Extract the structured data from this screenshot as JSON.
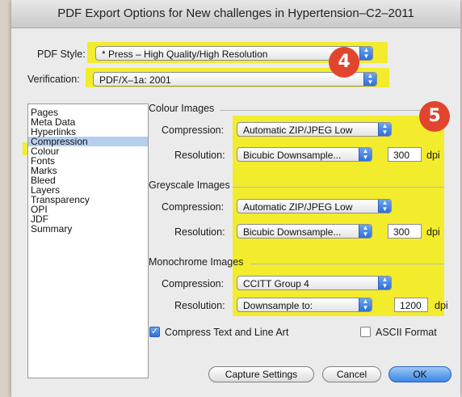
{
  "window": {
    "title": "PDF Export Options for New challenges in Hypertension–C2–2011"
  },
  "pdf_style": {
    "label": "PDF Style:",
    "value": "* Press – High Quality/High Resolution"
  },
  "verification": {
    "label": "Verification:",
    "value": "PDF/X–1a: 2001"
  },
  "sidebar": {
    "items": [
      {
        "label": "Pages"
      },
      {
        "label": "Meta Data"
      },
      {
        "label": "Hyperlinks"
      },
      {
        "label": "Compression"
      },
      {
        "label": "Colour"
      },
      {
        "label": "Fonts"
      },
      {
        "label": "Marks"
      },
      {
        "label": "Bleed"
      },
      {
        "label": "Layers"
      },
      {
        "label": "Transparency"
      },
      {
        "label": "OPI"
      },
      {
        "label": "JDF"
      },
      {
        "label": "Summary"
      }
    ],
    "selected": "Compression"
  },
  "colour_images": {
    "title": "Colour Images",
    "compression_label": "Compression:",
    "compression_value": "Automatic ZIP/JPEG Low",
    "resolution_label": "Resolution:",
    "resolution_method": "Bicubic Downsample...",
    "resolution_value": "300",
    "unit": "dpi"
  },
  "greyscale_images": {
    "title": "Greyscale Images",
    "compression_label": "Compression:",
    "compression_value": "Automatic ZIP/JPEG Low",
    "resolution_label": "Resolution:",
    "resolution_method": "Bicubic Downsample...",
    "resolution_value": "300",
    "unit": "dpi"
  },
  "monochrome_images": {
    "title": "Monochrome Images",
    "compression_label": "Compression:",
    "compression_value": "CCITT Group 4",
    "resolution_label": "Resolution:",
    "resolution_method": "Downsample to:",
    "resolution_value": "1200",
    "unit": "dpi"
  },
  "options": {
    "compress_text": {
      "label": "Compress Text and Line Art",
      "checked": true
    },
    "ascii_format": {
      "label": "ASCII Format",
      "checked": false
    }
  },
  "buttons": {
    "capture": "Capture Settings",
    "cancel": "Cancel",
    "ok": "OK"
  },
  "badges": {
    "step4": "4",
    "step5": "5"
  },
  "colors": {
    "highlight": "#f2ec1c",
    "badge": "#e2452e",
    "accent_blue": "#2f6fd6",
    "selection": "#b5d0ee"
  }
}
